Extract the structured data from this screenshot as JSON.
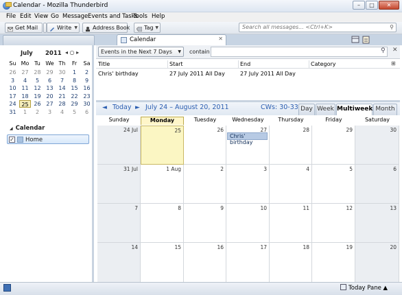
{
  "window": {
    "title": "Calendar - Mozilla Thunderbird",
    "min": "–",
    "max": "□",
    "close": "✕"
  },
  "menu": [
    "File",
    "Edit",
    "View",
    "Go",
    "Message",
    "Events and Tasks",
    "Tools",
    "Help"
  ],
  "toolbar": {
    "get_mail": "Get Mail",
    "write": "Write",
    "address_book": "Address Book",
    "tag": "Tag",
    "search_placeholder": "Search all messages... <Ctrl+K>"
  },
  "tabs": {
    "calendar": "Calendar"
  },
  "mini_calendar": {
    "month": "July",
    "year": "2011",
    "nav": "◂ ○ ▸",
    "dow": [
      "Su",
      "Mo",
      "Tu",
      "We",
      "Th",
      "Fr",
      "Sa"
    ],
    "weeks": [
      [
        "26",
        "27",
        "28",
        "29",
        "30",
        "1",
        "2"
      ],
      [
        "3",
        "4",
        "5",
        "6",
        "7",
        "8",
        "9"
      ],
      [
        "10",
        "11",
        "12",
        "13",
        "14",
        "15",
        "16"
      ],
      [
        "17",
        "18",
        "19",
        "20",
        "21",
        "22",
        "23"
      ],
      [
        "24",
        "25",
        "26",
        "27",
        "28",
        "29",
        "30"
      ],
      [
        "31",
        "1",
        "2",
        "3",
        "4",
        "5",
        "6"
      ]
    ]
  },
  "calendars": {
    "section": "Calendar",
    "items": [
      {
        "name": "Home",
        "checked": "✓"
      }
    ]
  },
  "filter": {
    "selected": "Events in the Next 7 Days",
    "contain": "contain"
  },
  "event_list": {
    "columns": [
      "Title",
      "Start",
      "End",
      "Category"
    ],
    "rows": [
      {
        "title": "Chris' birthday",
        "start": "27 July 2011 All Day",
        "end": "27 July 2011 All Day",
        "category": ""
      }
    ]
  },
  "nav": {
    "prev": "◄",
    "today": "Today",
    "next": "►",
    "range": "July 24 – August 20, 2011",
    "cws": "CWs: 30-33"
  },
  "views": [
    "Day",
    "Week",
    "Multiweek",
    "Month"
  ],
  "grid": {
    "dow": [
      "Sunday",
      "Monday",
      "Tuesday",
      "Wednesday",
      "Thursday",
      "Friday",
      "Saturday"
    ],
    "weeks": [
      [
        "24 Jul",
        "25",
        "26",
        "27",
        "28",
        "29",
        "30"
      ],
      [
        "31 Jul",
        "1 Aug",
        "2",
        "3",
        "4",
        "5",
        "6"
      ],
      [
        "7",
        "8",
        "9",
        "10",
        "11",
        "12",
        "13"
      ],
      [
        "14",
        "15",
        "16",
        "17",
        "18",
        "19",
        "20"
      ]
    ],
    "event": "Chris' birthday"
  },
  "status": {
    "today_pane": "Today Pane ▲"
  },
  "colors": {
    "accent": "#2a5db0",
    "today_fill": "#fbf6c3",
    "event_fill": "#b7cae4",
    "weekend_fill": "#ebeef2"
  }
}
